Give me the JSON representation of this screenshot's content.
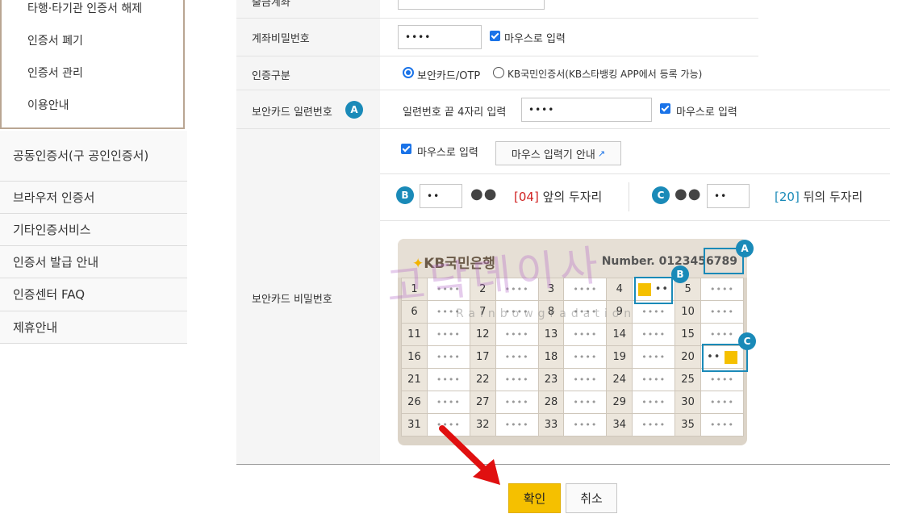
{
  "sidebar": {
    "sub_items": [
      "타행·타기관 인증서 해제",
      "인증서 폐기",
      "인증서 관리",
      "이용안내"
    ],
    "items": [
      "공동인증서(구 공인인증서)",
      "브라우저 인증서",
      "기타인증서비스",
      "인증서 발급 안내",
      "인증센터 FAQ",
      "제휴안내"
    ]
  },
  "form": {
    "top_label": "출금계좌",
    "account_pw_label": "계좌비밀번호",
    "account_pw_value": "••••",
    "mouse_input": "마우스로 입력",
    "auth_type_label": "인증구분",
    "auth_option_1": "보안카드/OTP",
    "auth_option_2": "KB국민인증서(KB스타뱅킹 APP에서 등록 가능)",
    "serial_label": "보안카드 일련번호",
    "serial_prompt": "일련번호 끝 4자리 입력",
    "serial_value": "••••",
    "card_pw_label": "보안카드 비밀번호",
    "guide_button": "마우스 입력기 안내",
    "front_value": "••",
    "front_masked": "●●",
    "front_code": "[04]",
    "front_text": "앞의 두자리",
    "back_value": "••",
    "back_masked": "●●",
    "back_code": "[20]",
    "back_text": "뒤의 두자리",
    "badge_a": "A",
    "badge_b": "B",
    "badge_c": "C"
  },
  "card": {
    "bank_name": "KB국민은행",
    "number_label": "Number. 0123456789",
    "rows": [
      [
        1,
        2,
        3,
        4,
        5
      ],
      [
        6,
        7,
        8,
        9,
        10
      ],
      [
        11,
        12,
        13,
        14,
        15
      ],
      [
        16,
        17,
        18,
        19,
        20
      ],
      [
        21,
        22,
        23,
        24,
        25
      ],
      [
        26,
        27,
        28,
        29,
        30
      ],
      [
        31,
        32,
        33,
        34,
        35
      ]
    ],
    "cell_mask": "••••",
    "cell4_value": "••",
    "cell20_value": "••"
  },
  "watermark": {
    "main": "고닥데이사",
    "sub": "Rainbowgradation"
  },
  "buttons": {
    "ok": "확인",
    "cancel": "취소"
  },
  "colors": {
    "accent": "#1a8ab8",
    "ok_button": "#f5c000",
    "code_red": "#d02020",
    "code_teal": "#1a8ab8"
  }
}
